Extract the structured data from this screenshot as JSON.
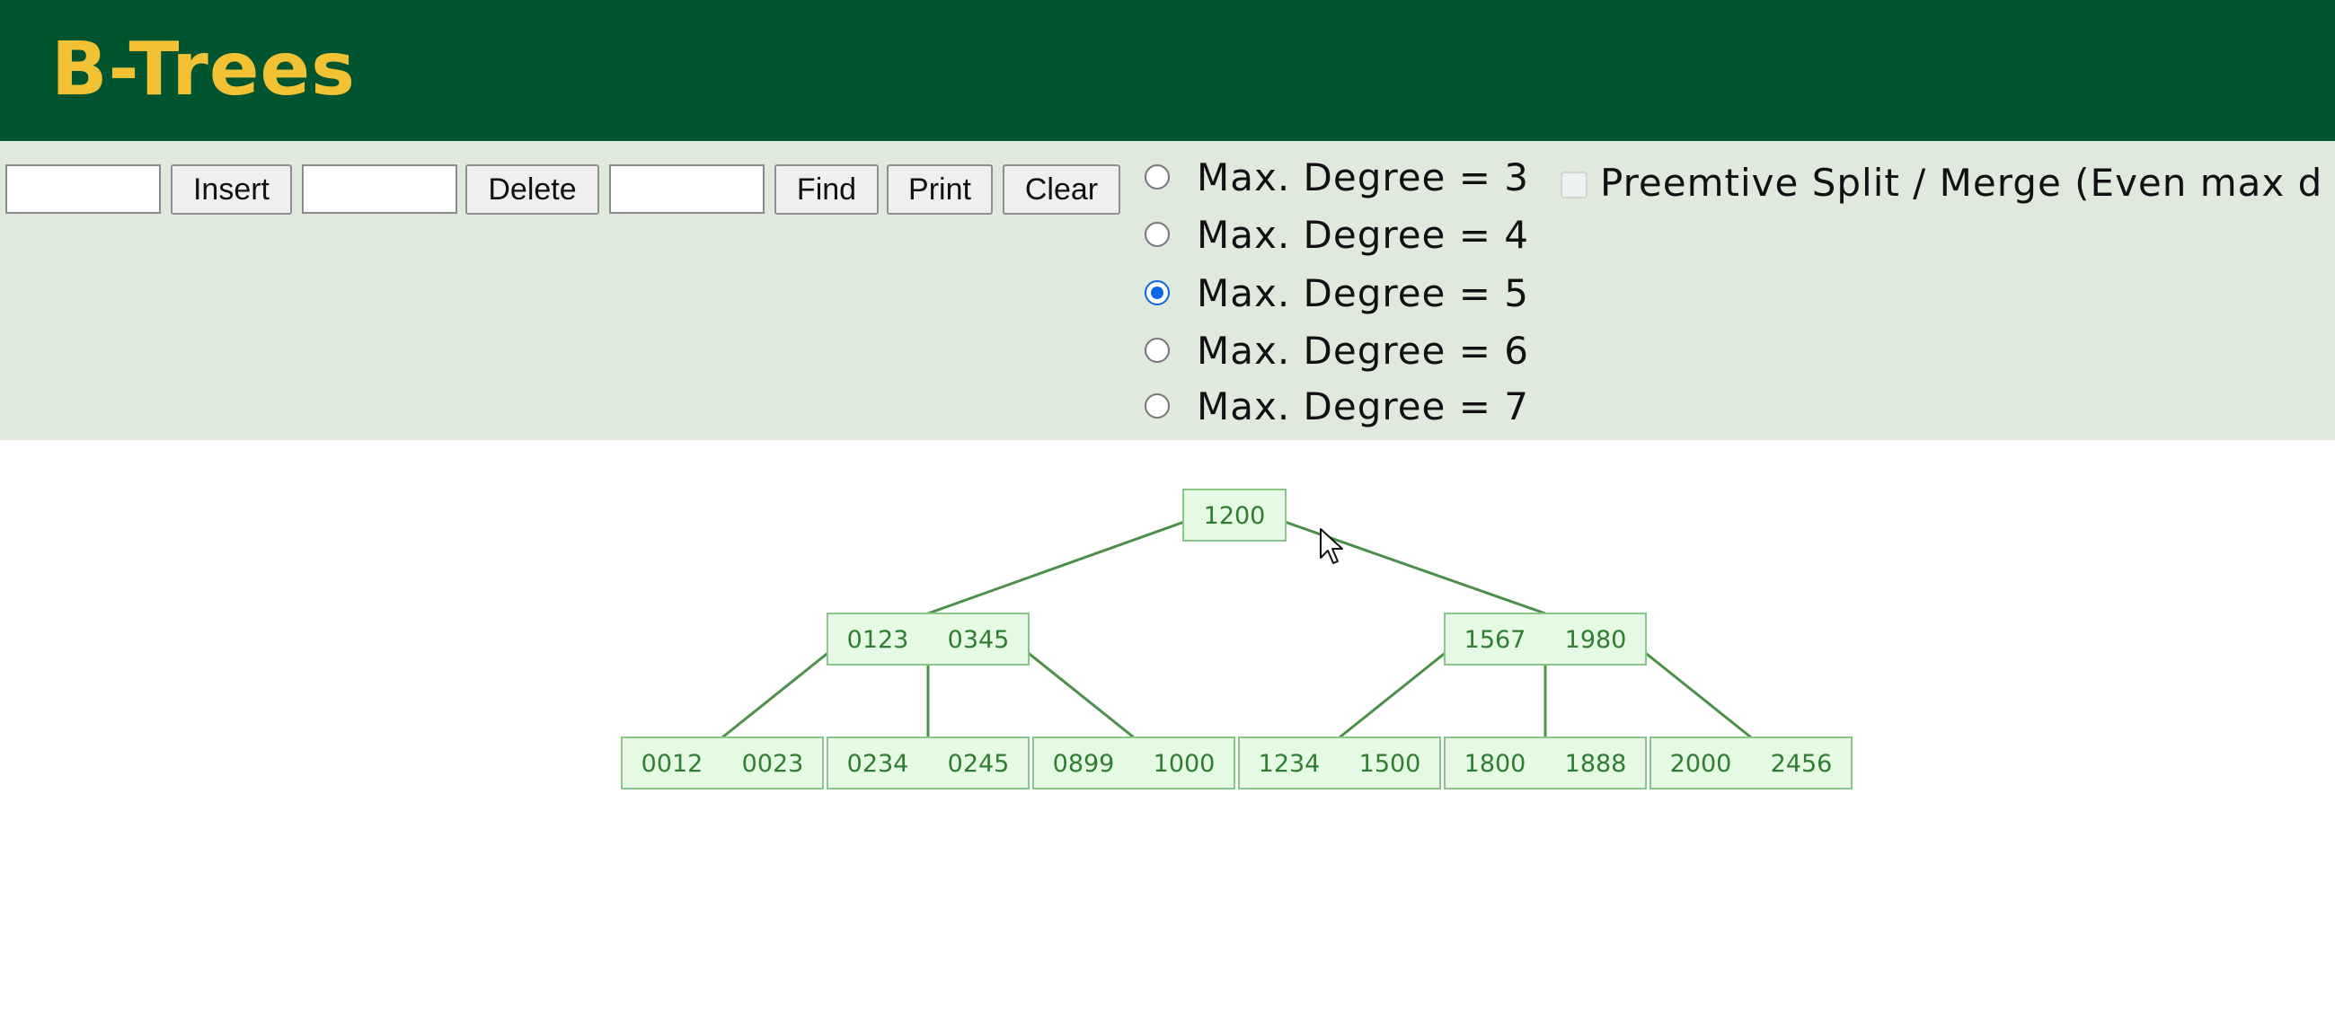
{
  "header": {
    "title": "B-Trees"
  },
  "toolbar": {
    "insert_input": "",
    "insert_label": "Insert",
    "delete_input": "",
    "delete_label": "Delete",
    "find_input": "",
    "find_label": "Find",
    "print_label": "Print",
    "clear_label": "Clear",
    "degree_options": [
      {
        "label": "Max. Degree = 3",
        "checked": false
      },
      {
        "label": "Max. Degree = 4",
        "checked": false
      },
      {
        "label": "Max. Degree = 5",
        "checked": true
      },
      {
        "label": "Max. Degree = 6",
        "checked": false
      },
      {
        "label": "Max. Degree = 7",
        "checked": false
      }
    ],
    "split_label": "Preemtive Split / Merge (Even max d",
    "split_checked": false
  },
  "tree": {
    "node_fill": "#e6f9e5",
    "node_stroke": "#8ac58a",
    "edge_color": "#4a8f4a",
    "text_color": "#2e7d32",
    "levels": [
      [
        {
          "keys": [
            "1200"
          ]
        }
      ],
      [
        {
          "keys": [
            "0123",
            "0345"
          ]
        },
        {
          "keys": [
            "1567",
            "1980"
          ]
        }
      ],
      [
        {
          "keys": [
            "0012",
            "0023"
          ]
        },
        {
          "keys": [
            "0234",
            "0245"
          ]
        },
        {
          "keys": [
            "0899",
            "1000"
          ]
        },
        {
          "keys": [
            "1234",
            "1500"
          ]
        },
        {
          "keys": [
            "1800",
            "1888"
          ]
        },
        {
          "keys": [
            "2000",
            "2456"
          ]
        }
      ]
    ]
  }
}
